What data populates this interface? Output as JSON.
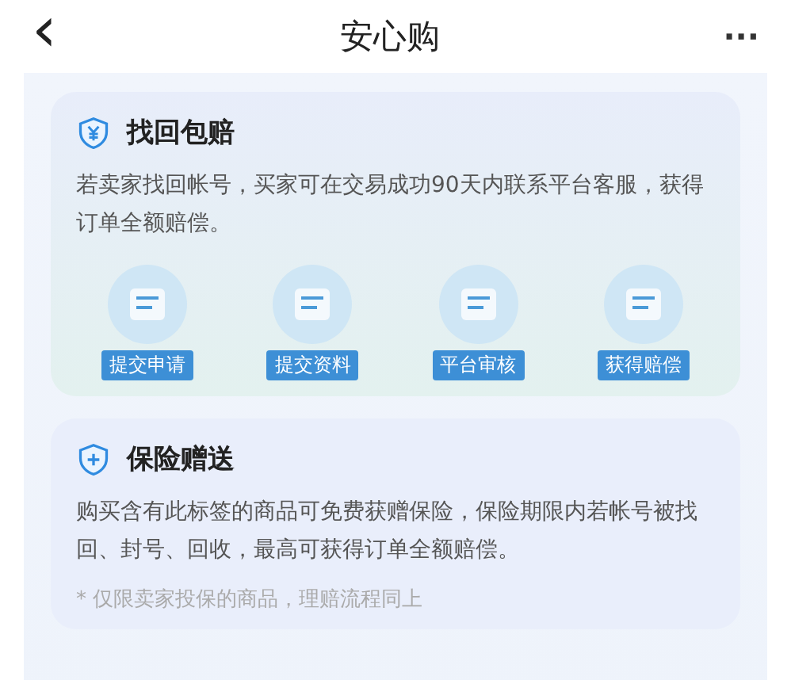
{
  "header": {
    "back": "‹",
    "title": "安心购",
    "more": "···"
  },
  "cards": [
    {
      "kind": "recover",
      "title": "找回包赔",
      "text": "若卖家找回帐号，买家可在交易成功90天内联系平台客服，获得订单全额赔偿。",
      "steps": [
        {
          "label": "提交申请"
        },
        {
          "label": "提交资料"
        },
        {
          "label": "平台审核"
        },
        {
          "label": "获得赔偿"
        }
      ]
    },
    {
      "kind": "insurance",
      "title": "保险赠送",
      "text": "购买含有此标签的商品可免费获赠保险，保险期限内若帐号被找回、封号、回收，最高可获得订单全额赔偿。",
      "note": "* 仅限卖家投保的商品，理赔流程同上"
    }
  ]
}
